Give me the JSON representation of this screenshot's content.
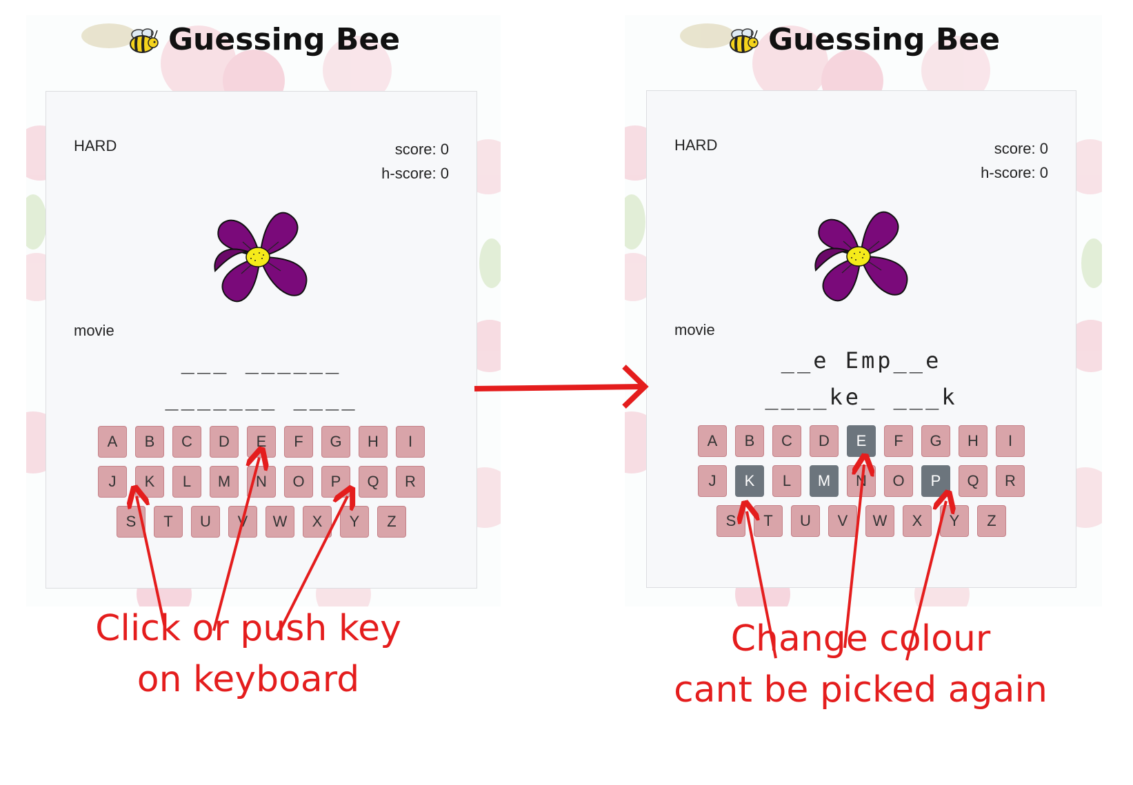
{
  "before": {
    "app_title": "Guessing Bee",
    "difficulty": "HARD",
    "score": "score: 0",
    "high_score": "h-score: 0",
    "category": "movie",
    "phrase_line1": "___ ______",
    "phrase_line2": "_______ ____",
    "keyboard_rows": [
      [
        "A",
        "B",
        "C",
        "D",
        "E",
        "F",
        "G",
        "H",
        "I"
      ],
      [
        "J",
        "K",
        "L",
        "M",
        "N",
        "O",
        "P",
        "Q",
        "R"
      ],
      [
        "S",
        "T",
        "U",
        "V",
        "W",
        "X",
        "Y",
        "Z"
      ]
    ],
    "used_keys": []
  },
  "after": {
    "app_title": "Guessing Bee",
    "difficulty": "HARD",
    "score": "score: 0",
    "high_score": "h-score: 0",
    "category": "movie",
    "phrase_line1": "__e Emp__e",
    "phrase_line2": "____ke_ ___k",
    "keyboard_rows": [
      [
        "A",
        "B",
        "C",
        "D",
        "E",
        "F",
        "G",
        "H",
        "I"
      ],
      [
        "J",
        "K",
        "L",
        "M",
        "N",
        "O",
        "P",
        "Q",
        "R"
      ],
      [
        "S",
        "T",
        "U",
        "V",
        "W",
        "X",
        "Y",
        "Z"
      ]
    ],
    "used_keys": [
      "E",
      "K",
      "M",
      "P"
    ]
  },
  "annotations": {
    "left_caption_line1": "Click or push key",
    "left_caption_line2": "on keyboard",
    "right_caption_line1": "Change colour",
    "right_caption_line2": "cant be picked again"
  },
  "colors": {
    "key_default": "#d9a4a9",
    "key_used": "#6c757d",
    "annotation_red": "#e41d1d",
    "flower_petal": "#7a0a7a",
    "flower_center": "#f5ea1a"
  },
  "icons": [
    "bee-icon",
    "flower-icon",
    "arrow-icon"
  ]
}
